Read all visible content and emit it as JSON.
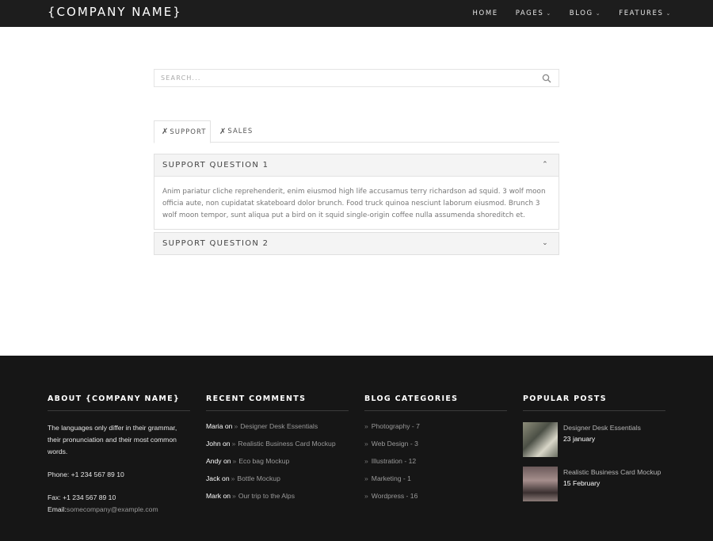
{
  "nav": {
    "logo": "{COMPANY NAME}",
    "items": [
      {
        "label": "HOME",
        "caret": false
      },
      {
        "label": "PAGES",
        "caret": true
      },
      {
        "label": "BLOG",
        "caret": true
      },
      {
        "label": "FEATURES",
        "caret": true
      }
    ]
  },
  "search": {
    "placeholder": "SEARCH..."
  },
  "tabs": [
    {
      "label": "SUPPORT",
      "icon": "tools-icon",
      "active": true
    },
    {
      "label": "SALES",
      "icon": "tools-icon",
      "active": false
    }
  ],
  "accordion": [
    {
      "title": "SUPPORT QUESTION 1",
      "expanded": true,
      "body": "Anim pariatur cliche reprehenderit, enim eiusmod high life accusamus terry richardson ad squid. 3 wolf moon officia aute, non cupidatat skateboard dolor brunch. Food truck quinoa nesciunt laborum eiusmod. Brunch 3 wolf moon tempor, sunt aliqua put a bird on it squid single-origin coffee nulla assumenda shoreditch et."
    },
    {
      "title": "SUPPORT QUESTION 2",
      "expanded": false,
      "body": ""
    }
  ],
  "footer": {
    "about": {
      "heading": "ABOUT {COMPANY NAME}",
      "text": "The languages only differ in their grammar, their pronunciation and their most common words.",
      "phone": "Phone: +1 234 567 89 10",
      "fax": "Fax: +1 234 567 89 10",
      "email_label": "Email:",
      "email": "somecompany@example.com"
    },
    "comments": {
      "heading": "RECENT COMMENTS",
      "items": [
        {
          "author": "Maria on",
          "post": "Designer Desk Essentials"
        },
        {
          "author": "John on",
          "post": "Realistic Business Card Mockup"
        },
        {
          "author": "Andy on",
          "post": "Eco bag Mockup"
        },
        {
          "author": "Jack on",
          "post": "Bottle Mockup"
        },
        {
          "author": "Mark on",
          "post": "Our trip to the Alps"
        }
      ]
    },
    "categories": {
      "heading": "BLOG CATEGORIES",
      "items": [
        "Photography - 7",
        "Web Design - 3",
        "Illustration - 12",
        "Marketing - 1",
        "Wordpress - 16"
      ]
    },
    "popular": {
      "heading": "POPULAR POSTS",
      "items": [
        {
          "title": "Designer Desk Essentials",
          "date": "23 january"
        },
        {
          "title": "Realistic Business Card Mockup",
          "date": "15 February"
        }
      ]
    }
  },
  "colors": {
    "nav_bg": "#1d1d1d",
    "footer_bg": "#161616",
    "accordion_head_bg": "#f4f4f4"
  }
}
